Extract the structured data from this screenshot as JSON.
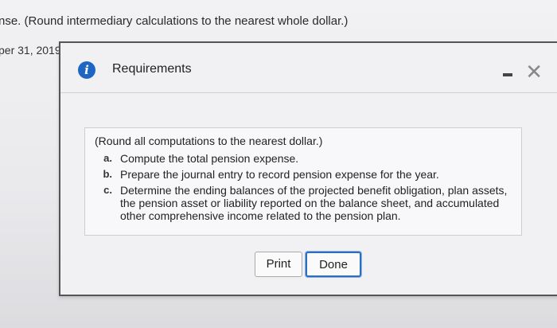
{
  "background": {
    "instruction_text": "nse. (Round intermediary calculations to the nearest whole dollar.)",
    "date_text": "per 31, 2019"
  },
  "dialog": {
    "title": "Requirements",
    "info_icon": "i",
    "minimize_icon": "minimize-icon",
    "close_glyph": "✕",
    "intro": "(Round all computations to the nearest dollar.)",
    "items": [
      {
        "letter": "a.",
        "text": "Compute the total pension expense."
      },
      {
        "letter": "b.",
        "text": "Prepare the journal entry to record pension expense for the year."
      },
      {
        "letter": "c.",
        "text": "Determine the ending balances of the projected benefit obligation, plan assets, the pension asset or liability reported on the balance sheet, and accumulated other comprehensive income related to the pension plan."
      }
    ],
    "print_label": "Print",
    "done_label": "Done"
  },
  "colors": {
    "accent": "#1f66c2",
    "done_border": "#2a6fbf"
  }
}
